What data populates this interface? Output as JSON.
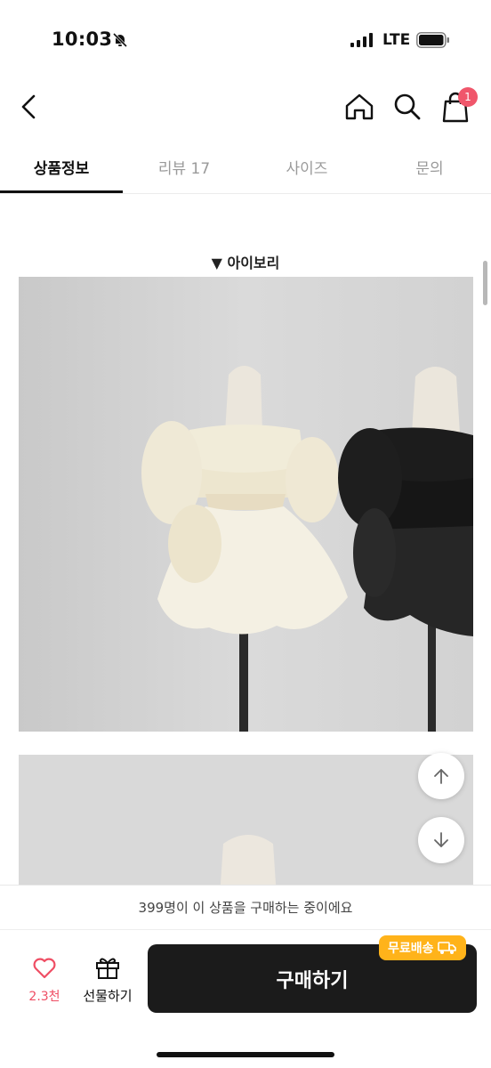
{
  "status_bar": {
    "time": "10:03",
    "network": "LTE"
  },
  "header": {
    "cart_count": "1"
  },
  "tabs": [
    {
      "label": "상품정보",
      "active": true
    },
    {
      "label": "리뷰 17",
      "active": false
    },
    {
      "label": "사이즈",
      "active": false
    },
    {
      "label": "문의",
      "active": false
    }
  ],
  "content": {
    "color_option_label": "▼ 아이보리"
  },
  "purchase_notice": "399명이 이 상품을 구매하는 중이에요",
  "bottom_bar": {
    "like_count": "2.3천",
    "gift_label": "선물하기",
    "buy_label": "구매하기",
    "free_shipping_badge": "무료배송"
  },
  "colors": {
    "accent": "#f0566b",
    "buy_button": "#1b1b1b",
    "badge": "#ffb31a"
  }
}
